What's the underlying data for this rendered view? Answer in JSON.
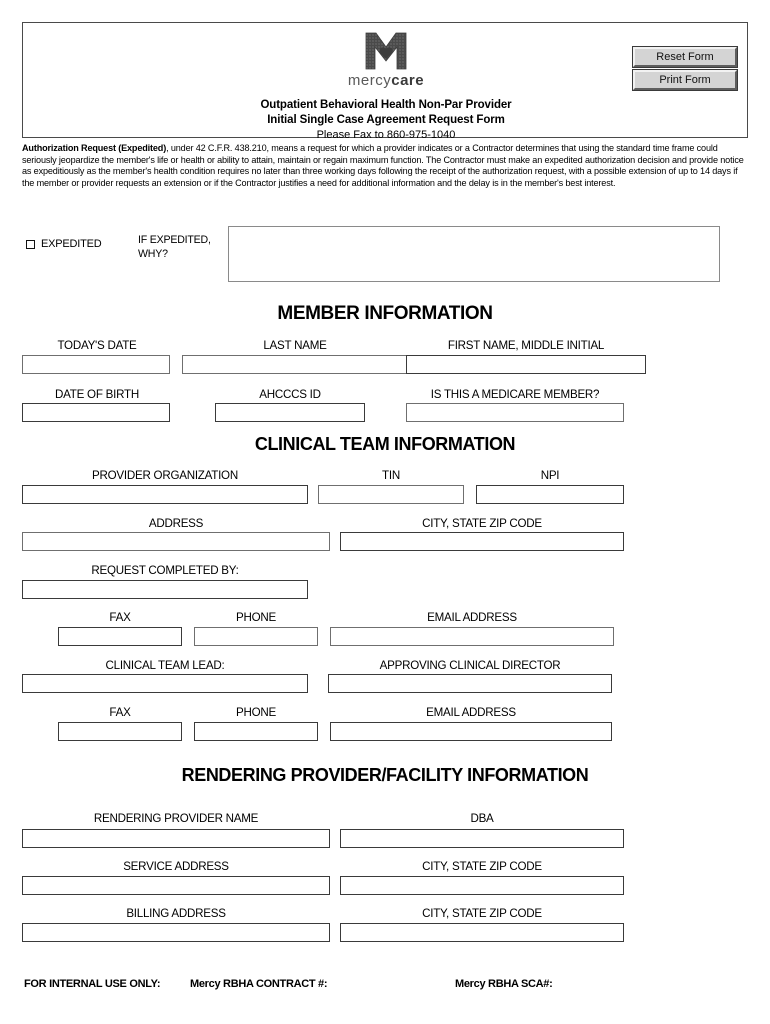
{
  "header": {
    "logo": {
      "icon": "mercy-care-m-heart-logo",
      "word_light": "mercy",
      "word_bold": "care"
    },
    "title_line1": "Outpatient Behavioral Health Non-Par Provider",
    "title_line2": "Initial Single Case Agreement Request Form",
    "fax_line": "Please Fax to 860-975-1040",
    "buttons": {
      "reset": "Reset Form",
      "print": "Print Form"
    }
  },
  "disclaimer": {
    "lead": "Authorization Request (Expedited)",
    "body": ", under 42 C.F.R. 438.210, means a request for which a provider indicates or a Contractor determines that using the standard time frame could seriously jeopardize the member's life or health or ability to attain, maintain or regain maximum function. The Contractor must make an expedited authorization decision and provide notice as expeditiously as the member's health condition requires no later than three working days following the receipt of the authorization request, with a possible extension of up to 14 days if the member or provider requests an extension or if the Contractor justifies a need for additional information and the delay is in the member's best interest."
  },
  "expedited": {
    "checkbox_label": "EXPEDITED",
    "checked": false,
    "why_label": "IF EXPEDITED, WHY?",
    "why_value": "",
    "why_placeholder": ""
  },
  "sections": {
    "member": "MEMBER INFORMATION",
    "clinical": "CLINICAL TEAM INFORMATION",
    "rendering": "RENDERING PROVIDER/FACILITY INFORMATION"
  },
  "member_fields": {
    "todays_date": {
      "label": "TODAY'S DATE",
      "value": ""
    },
    "last_name": {
      "label": "LAST NAME",
      "value": ""
    },
    "first_name": {
      "label": "FIRST NAME, MIDDLE INITIAL",
      "value": ""
    },
    "date_of_birth": {
      "label": "DATE OF BIRTH",
      "value": ""
    },
    "ahcccs_id": {
      "label": "AHCCCS ID",
      "value": ""
    },
    "medicare_member": {
      "label": "IS THIS A MEDICARE MEMBER?",
      "value": ""
    }
  },
  "clinical_fields": {
    "provider_org": {
      "label": "PROVIDER ORGANIZATION",
      "value": ""
    },
    "tin": {
      "label": "TIN",
      "value": ""
    },
    "npi": {
      "label": "NPI",
      "value": ""
    },
    "address": {
      "label": "ADDRESS",
      "value": ""
    },
    "city_state_zip": {
      "label": "CITY, STATE ZIP CODE",
      "value": ""
    },
    "request_completed_by": {
      "label": "REQUEST COMPLETED BY:",
      "value": ""
    },
    "fax1": {
      "label": "FAX",
      "value": ""
    },
    "phone1": {
      "label": "PHONE",
      "value": ""
    },
    "email1": {
      "label": "EMAIL ADDRESS",
      "value": ""
    },
    "clinical_team_lead": {
      "label": "CLINICAL TEAM LEAD:",
      "value": ""
    },
    "approving_director": {
      "label": "APPROVING CLINICAL DIRECTOR",
      "value": ""
    },
    "fax2": {
      "label": "FAX",
      "value": ""
    },
    "phone2": {
      "label": "PHONE",
      "value": ""
    },
    "email2": {
      "label": "EMAIL ADDRESS",
      "value": ""
    }
  },
  "rendering_fields": {
    "provider_name": {
      "label": "RENDERING PROVIDER NAME",
      "value": ""
    },
    "dba": {
      "label": "DBA",
      "value": ""
    },
    "service_address": {
      "label": "SERVICE ADDRESS",
      "value": ""
    },
    "service_city_state_zip": {
      "label": "CITY, STATE ZIP CODE",
      "value": ""
    },
    "billing_address": {
      "label": "BILLING ADDRESS",
      "value": ""
    },
    "billing_city_state_zip": {
      "label": "CITY, STATE ZIP CODE",
      "value": ""
    }
  },
  "footer": {
    "internal_use": "FOR INTERNAL USE ONLY:",
    "contract": "Mercy RBHA CONTRACT #:",
    "sca": "Mercy RBHA SCA#:"
  },
  "colors": {
    "logo_gray": "#4a4a4a",
    "field_border": "#6f6f6f",
    "button_face": "#d4d4d4",
    "text": "#000000"
  }
}
